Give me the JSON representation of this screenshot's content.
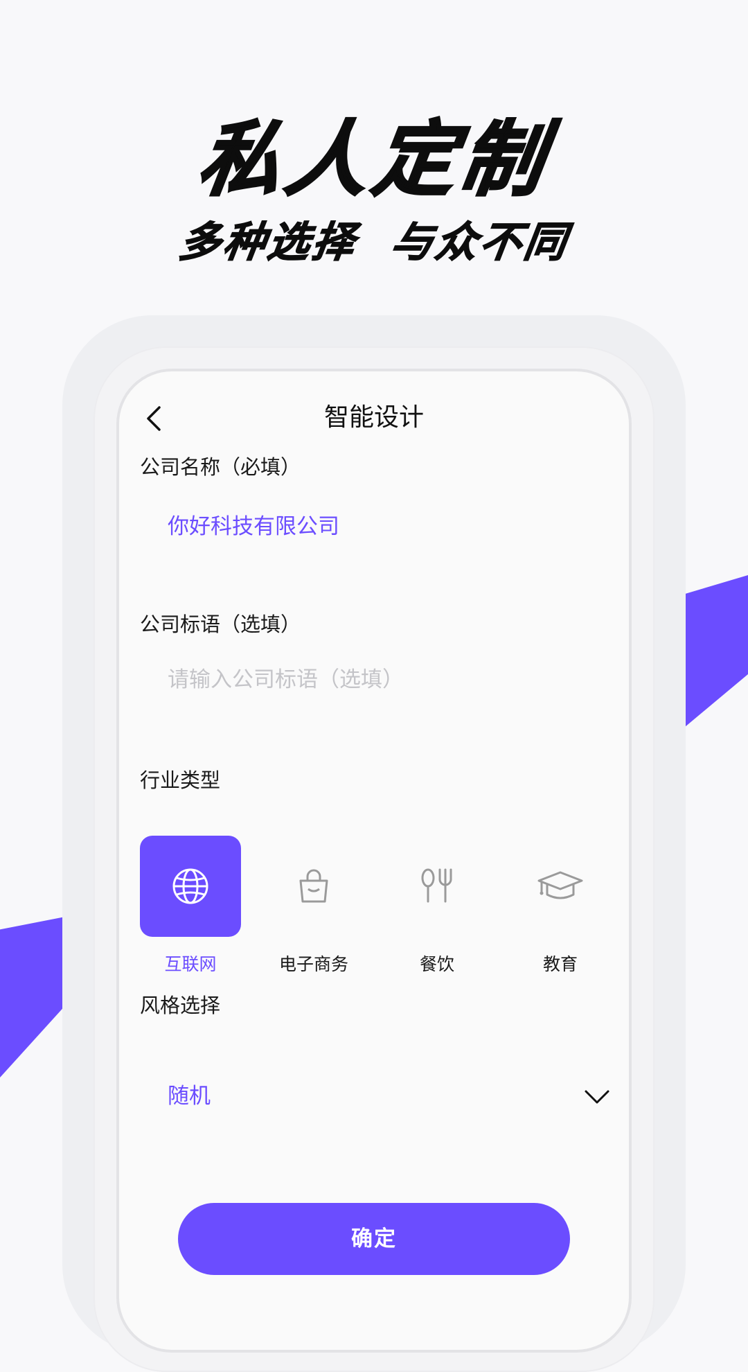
{
  "hero": {
    "title": "私人定制",
    "subtitle": "多种选择  与众不同"
  },
  "nav": {
    "back_icon": "chevron-left-icon",
    "title": "智能设计"
  },
  "company_name": {
    "label": "公司名称（必填）",
    "value": "你好科技有限公司",
    "placeholder": ""
  },
  "company_slogan": {
    "label": "公司标语（选填）",
    "value": "",
    "placeholder": "请输入公司标语（选填）"
  },
  "industry": {
    "label": "行业类型",
    "selected": "互联网",
    "options": [
      {
        "label": "互联网",
        "icon": "globe-icon",
        "active": true
      },
      {
        "label": "电子商务",
        "icon": "shopping-bag-icon",
        "active": false
      },
      {
        "label": "餐饮",
        "icon": "utensils-icon",
        "active": false
      },
      {
        "label": "教育",
        "icon": "graduation-cap-icon",
        "active": false
      }
    ]
  },
  "style": {
    "label": "风格选择",
    "value": "随机",
    "icon": "chevron-down-icon"
  },
  "confirm": {
    "label": "确定"
  },
  "colors": {
    "accent": "#6b4dff",
    "text": "#1a1a1a",
    "placeholder": "#c4c4c8",
    "icon_inactive": "#9a9a9a"
  }
}
